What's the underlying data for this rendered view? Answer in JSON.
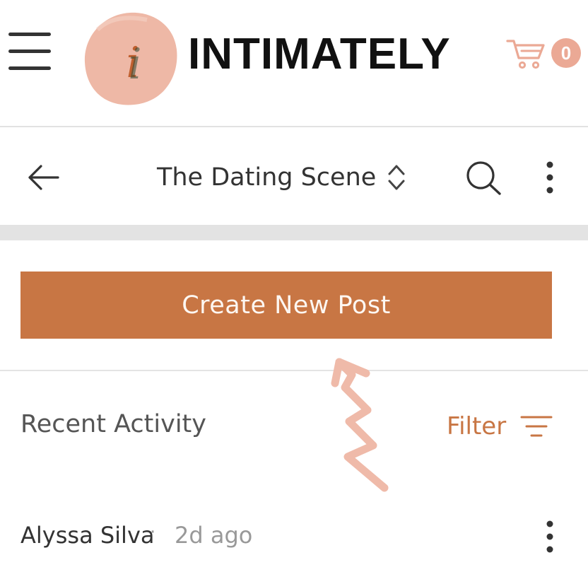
{
  "header": {
    "brand_name": "INTIMATELY",
    "logo_letter": "i",
    "cart_count": "0",
    "accent_color": "#eba995"
  },
  "group_nav": {
    "title": "The Dating Scene"
  },
  "create_post": {
    "label": "Create New Post",
    "color": "#c87644"
  },
  "activity": {
    "heading": "Recent Activity",
    "filter_label": "Filter"
  },
  "posts": [
    {
      "author": "Alyssa Silva",
      "separator": "·",
      "time": "2d ago"
    }
  ],
  "icons": {
    "menu": "hamburger-icon",
    "cart": "cart-icon",
    "back": "arrow-left-icon",
    "switcher": "chevron-up-down-icon",
    "search": "search-icon",
    "more": "more-vertical-icon",
    "filter": "filter-icon"
  }
}
